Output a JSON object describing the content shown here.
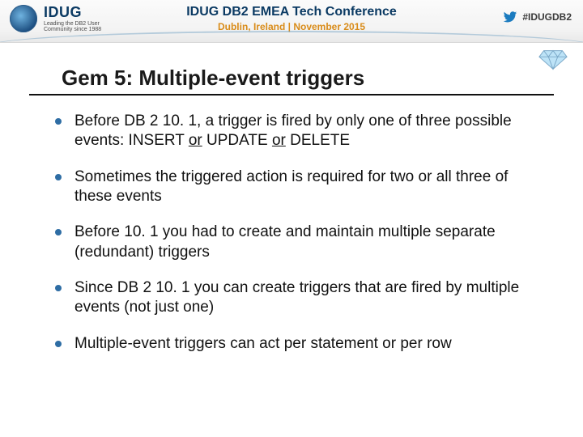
{
  "header": {
    "logo_text": "IDUG",
    "logo_tagline": "Leading the DB2 User Community since 1988",
    "conference_title": "IDUG DB2 EMEA Tech Conference",
    "conference_sub": "Dublin, Ireland  |  November 2015",
    "hashtag": "#IDUGDB2"
  },
  "slide": {
    "title": "Gem 5: Multiple-event triggers",
    "bullets": [
      {
        "pre": "Before DB 2 10. 1, a trigger is fired by only one of three possible events: INSERT ",
        "u1": "or",
        "mid": " UPDATE ",
        "u2": "or",
        "post": " DELETE"
      },
      {
        "text": "Sometimes the triggered action is required for two or all three of these events"
      },
      {
        "text": "Before 10. 1 you had to create and maintain multiple separate (redundant) triggers"
      },
      {
        "text": "Since DB 2 10. 1 you can create triggers that are fired by multiple events (not just one)"
      },
      {
        "text": "Multiple-event triggers can act per statement or per row"
      }
    ]
  }
}
